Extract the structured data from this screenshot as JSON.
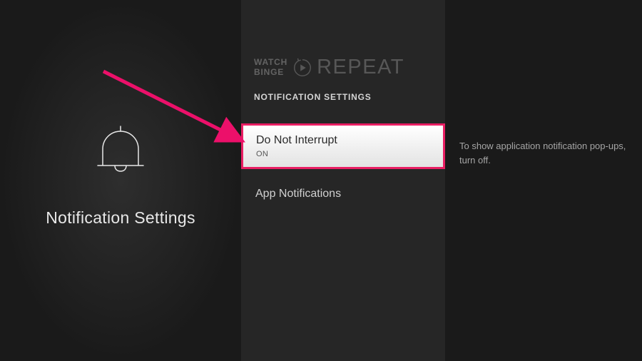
{
  "leftPanel": {
    "title": "Notification Settings"
  },
  "watermark": {
    "line1": "WATCH",
    "line2": "BINGE",
    "right": "REPEAT"
  },
  "sectionHeader": "NOTIFICATION SETTINGS",
  "menu": {
    "items": [
      {
        "title": "Do Not Interrupt",
        "status": "ON",
        "selected": true
      },
      {
        "title": "App Notifications",
        "status": "",
        "selected": false
      }
    ]
  },
  "helpText": "To show application notification pop-ups, turn off."
}
